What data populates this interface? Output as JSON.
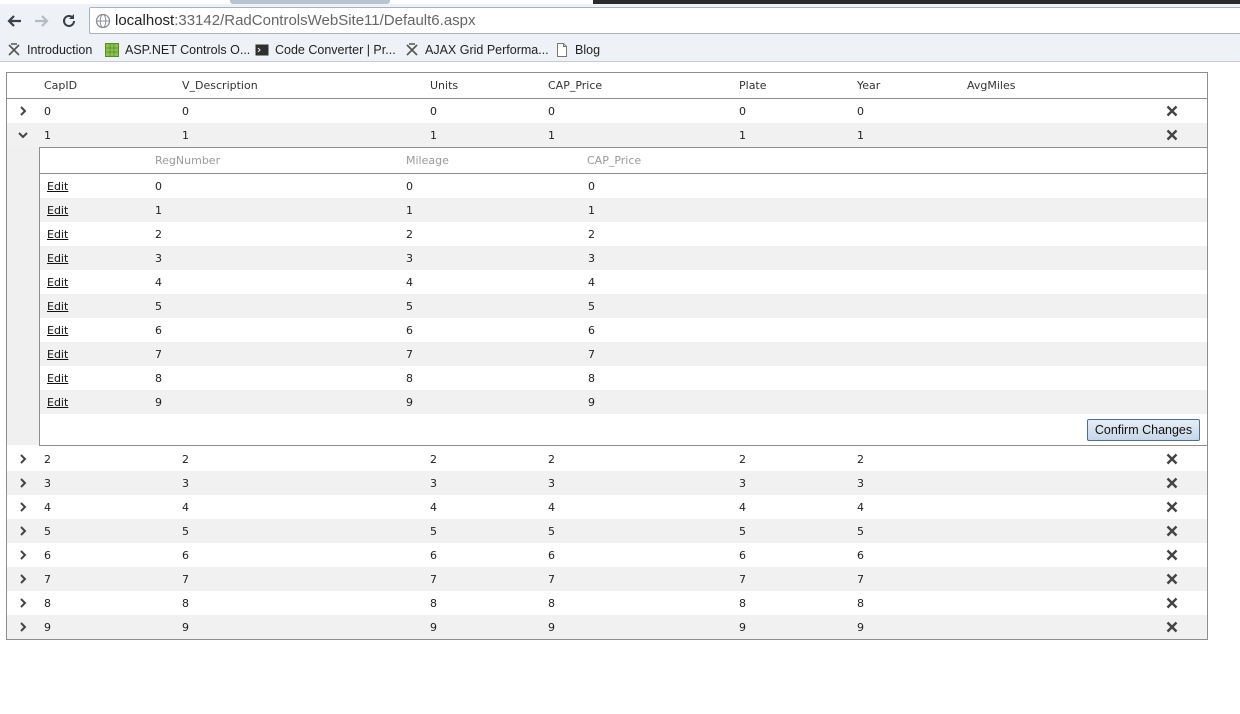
{
  "browser": {
    "url_host": "localhost",
    "url_rest": ":33142/RadControlsWebSite11/Default6.aspx",
    "bookmarks": [
      {
        "label": "Introduction",
        "icon": "telerik-icon"
      },
      {
        "label": "ASP.NET Controls O...",
        "icon": "grid-icon"
      },
      {
        "label": "Code Converter | Pr...",
        "icon": "terminal-icon"
      },
      {
        "label": "AJAX Grid Performa...",
        "icon": "telerik-icon"
      },
      {
        "label": "Blog",
        "icon": "page-icon"
      }
    ]
  },
  "grid": {
    "columns": [
      "CapID",
      "V_Description",
      "Units",
      "CAP_Price",
      "Plate",
      "Year",
      "AvgMiles"
    ],
    "rows_top": [
      {
        "cells": [
          "0",
          "0",
          "0",
          "0",
          "0",
          "0"
        ]
      },
      {
        "cells": [
          "1",
          "1",
          "1",
          "1",
          "1",
          "1"
        ]
      }
    ],
    "detail": {
      "columns": [
        "RegNumber",
        "Mileage",
        "CAP_Price"
      ],
      "edit_label": "Edit",
      "rows": [
        [
          "0",
          "0",
          "0"
        ],
        [
          "1",
          "1",
          "1"
        ],
        [
          "2",
          "2",
          "2"
        ],
        [
          "3",
          "3",
          "3"
        ],
        [
          "4",
          "4",
          "4"
        ],
        [
          "5",
          "5",
          "5"
        ],
        [
          "6",
          "6",
          "6"
        ],
        [
          "7",
          "7",
          "7"
        ],
        [
          "8",
          "8",
          "8"
        ],
        [
          "9",
          "9",
          "9"
        ]
      ],
      "confirm_label": "Confirm Changes"
    },
    "rows_bottom": [
      {
        "cells": [
          "2",
          "2",
          "2",
          "2",
          "2",
          "2"
        ]
      },
      {
        "cells": [
          "3",
          "3",
          "3",
          "3",
          "3",
          "3"
        ]
      },
      {
        "cells": [
          "4",
          "4",
          "4",
          "4",
          "4",
          "4"
        ]
      },
      {
        "cells": [
          "5",
          "5",
          "5",
          "5",
          "5",
          "5"
        ]
      },
      {
        "cells": [
          "6",
          "6",
          "6",
          "6",
          "6",
          "6"
        ]
      },
      {
        "cells": [
          "7",
          "7",
          "7",
          "7",
          "7",
          "7"
        ]
      },
      {
        "cells": [
          "8",
          "8",
          "8",
          "8",
          "8",
          "8"
        ]
      },
      {
        "cells": [
          "9",
          "9",
          "9",
          "9",
          "9",
          "9"
        ]
      }
    ]
  }
}
